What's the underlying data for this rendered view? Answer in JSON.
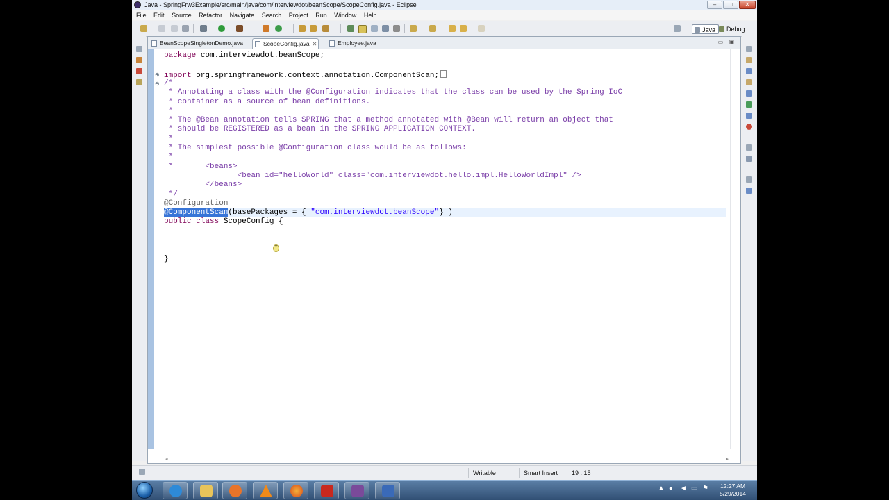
{
  "window": {
    "title": "Java - SpringFrw3Example/src/main/java/com/interviewdot/beanScope/ScopeConfig.java - Eclipse",
    "controls": [
      "–",
      "□",
      "✕"
    ]
  },
  "menu": [
    "File",
    "Edit",
    "Source",
    "Refactor",
    "Navigate",
    "Search",
    "Project",
    "Run",
    "Window",
    "Help"
  ],
  "perspectives": [
    {
      "label": "Java",
      "active": true
    },
    {
      "label": "Debug",
      "active": false
    }
  ],
  "tabs": [
    {
      "label": "BeanScopeSingletonDemo.java",
      "active": false
    },
    {
      "label": "ScopeConfig.java",
      "active": true,
      "close": "✕"
    },
    {
      "label": "Employee.java",
      "active": false
    }
  ],
  "editor": {
    "lines": [
      {
        "text": "package com.interviewdot.beanScope;",
        "kind": "package"
      },
      {
        "text": "",
        "kind": "blank"
      },
      {
        "text": "import org.springframework.context.annotation.ComponentScan;",
        "kind": "import",
        "fold": "⊕"
      },
      {
        "text": "/*",
        "kind": "comment",
        "fold": "⊖"
      },
      {
        "text": " * Annotating a class with the @Configuration indicates that the class can be used by the Spring IoC",
        "kind": "comment"
      },
      {
        "text": " * container as a source of bean definitions.",
        "kind": "comment"
      },
      {
        "text": " *",
        "kind": "comment"
      },
      {
        "text": " * The @Bean annotation tells SPRING that a method annotated with @Bean will return an object that",
        "kind": "comment"
      },
      {
        "text": " * should be REGISTERED as a bean in the SPRING APPLICATION CONTEXT.",
        "kind": "comment"
      },
      {
        "text": " *",
        "kind": "comment"
      },
      {
        "text": " * The simplest possible @Configuration class would be as follows:",
        "kind": "comment"
      },
      {
        "text": " *",
        "kind": "comment"
      },
      {
        "text": " *       <beans>",
        "kind": "comment"
      },
      {
        "text": "                <bean id=\"helloWorld\" class=\"com.interviewdot.hello.impl.HelloWorldImpl\" />",
        "kind": "comment"
      },
      {
        "text": "         </beans>",
        "kind": "comment"
      },
      {
        "text": " */",
        "kind": "comment"
      },
      {
        "text": "@Configuration",
        "kind": "annotation"
      },
      {
        "text": "@ComponentScan(basePackages = { \"com.interviewdot.beanScope\"} )",
        "kind": "scan"
      },
      {
        "text": "public class ScopeConfig {",
        "kind": "class"
      },
      {
        "text": "",
        "kind": "blank"
      },
      {
        "text": "",
        "kind": "blank"
      },
      {
        "text": "",
        "kind": "blank"
      },
      {
        "text": "}",
        "kind": "plain"
      }
    ],
    "selection": "@ComponentScan"
  },
  "status": {
    "writable": "Writable",
    "insert_mode": "Smart Insert",
    "position": "19 : 15"
  },
  "taskbar": {
    "time": "12:27 AM",
    "date": "5/29/2014",
    "apps": [
      "internet-explorer",
      "file-explorer",
      "media-player",
      "vlc",
      "firefox",
      "filezilla",
      "winrar",
      "save"
    ]
  },
  "colors": {
    "keyword": "#7f0055",
    "comment": "#7a3ea8",
    "annotation": "#646464",
    "string": "#2a00ff",
    "selection": "#3875d7",
    "current_line": "#e8f2fe"
  }
}
